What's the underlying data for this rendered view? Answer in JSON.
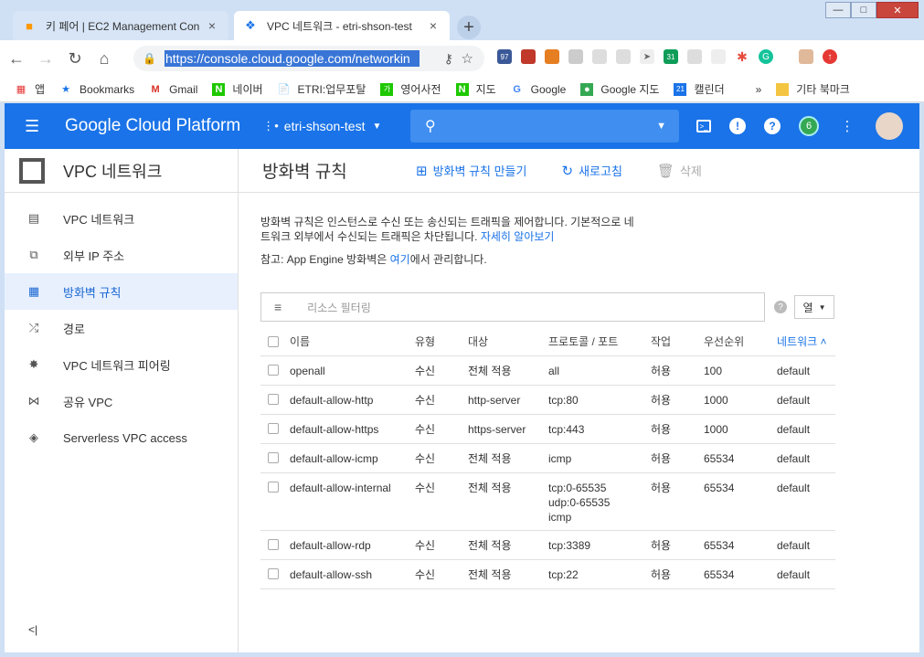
{
  "browser": {
    "tabs": [
      {
        "title": "키 페어 | EC2 Management Con",
        "icon": "aws-box-icon"
      },
      {
        "title": "VPC 네트워크 - etri-shson-test",
        "icon": "vpc-network-icon"
      }
    ],
    "url": "https://console.cloud.google.com/networkin",
    "bookmarks": [
      "앱",
      "Bookmarks",
      "Gmail",
      "네이버",
      "ETRI:업무포탈",
      "영어사전",
      "지도",
      "Google",
      "Google 지도",
      "캘린더",
      "»",
      "기타 북마크"
    ],
    "ext_badges": {
      "mail_count": "97",
      "calendar_count": "31"
    }
  },
  "header": {
    "product": "Google Cloud Platform",
    "project": "etri-shson-test",
    "notification_count": "6"
  },
  "sidebar": {
    "title": "VPC 네트워크",
    "items": [
      {
        "label": "VPC 네트워크",
        "icon": "vpc-icon"
      },
      {
        "label": "외부 IP 주소",
        "icon": "external-ip-icon"
      },
      {
        "label": "방화벽 규칙",
        "icon": "firewall-icon"
      },
      {
        "label": "경로",
        "icon": "routes-icon"
      },
      {
        "label": "VPC 네트워크 피어링",
        "icon": "peering-icon"
      },
      {
        "label": "공유 VPC",
        "icon": "shared-vpc-icon"
      },
      {
        "label": "Serverless VPC access",
        "icon": "serverless-icon"
      }
    ],
    "collapse": "<|"
  },
  "main": {
    "title": "방화벽 규칙",
    "actions": {
      "create": "방화벽 규칙 만들기",
      "refresh": "새로고침",
      "delete": "삭제"
    },
    "description_1": "방화벽 규칙은 인스턴스로 수신 또는 송신되는 트래픽을 제어합니다. 기본적으로 네",
    "description_2": "트워크 외부에서 수신되는 트래픽은 차단됩니다.",
    "learn_more": "자세히 알아보기",
    "note_prefix": "참고: App Engine 방화벽은 ",
    "note_link": "여기",
    "note_suffix": "에서 관리합니다.",
    "filter_placeholder": "리소스 필터링",
    "columns_button": "열",
    "table": {
      "headers": [
        "이름",
        "유형",
        "대상",
        "프로토콜 / 포트",
        "작업",
        "우선순위",
        "네트워크"
      ],
      "rows": [
        {
          "name": "openall",
          "type": "수신",
          "target": "전체 적용",
          "protocol": "all",
          "action": "허용",
          "priority": "100",
          "network": "default"
        },
        {
          "name": "default-allow-http",
          "type": "수신",
          "target": "http-server",
          "protocol": "tcp:80",
          "action": "허용",
          "priority": "1000",
          "network": "default"
        },
        {
          "name": "default-allow-https",
          "type": "수신",
          "target": "https-server",
          "protocol": "tcp:443",
          "action": "허용",
          "priority": "1000",
          "network": "default"
        },
        {
          "name": "default-allow-icmp",
          "type": "수신",
          "target": "전체 적용",
          "protocol": "icmp",
          "action": "허용",
          "priority": "65534",
          "network": "default"
        },
        {
          "name": "default-allow-internal",
          "type": "수신",
          "target": "전체 적용",
          "protocol": "tcp:0-65535\nudp:0-65535\nicmp",
          "action": "허용",
          "priority": "65534",
          "network": "default"
        },
        {
          "name": "default-allow-rdp",
          "type": "수신",
          "target": "전체 적용",
          "protocol": "tcp:3389",
          "action": "허용",
          "priority": "65534",
          "network": "default"
        },
        {
          "name": "default-allow-ssh",
          "type": "수신",
          "target": "전체 적용",
          "protocol": "tcp:22",
          "action": "허용",
          "priority": "65534",
          "network": "default"
        }
      ]
    }
  },
  "colors": {
    "accent": "#1a73e8",
    "header": "#1a73e8",
    "active_bg": "#e8f0fe"
  }
}
